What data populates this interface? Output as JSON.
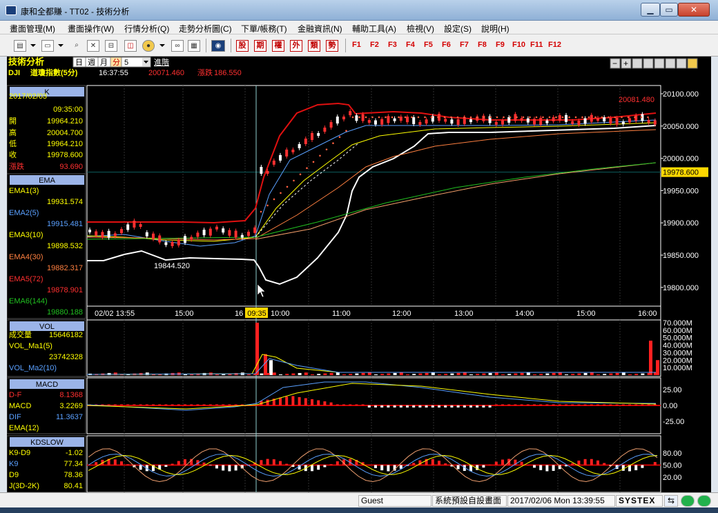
{
  "window": {
    "title": "康和全都賺 - TT02 - 技術分析"
  },
  "menu": [
    "畫面管理(M)",
    "畫面操作(W)",
    "行情分析(Q)",
    "走勢分析圖(C)",
    "下單/帳務(T)",
    "金融資訊(N)",
    "輔助工具(A)",
    "檢視(V)",
    "設定(S)",
    "說明(H)"
  ],
  "toolbar": {
    "quick": [
      "股",
      "期",
      "權",
      "外",
      "類",
      "勢"
    ],
    "fkeys": [
      "F1",
      "F2",
      "F3",
      "F4",
      "F5",
      "F6",
      "F7",
      "F8",
      "F9",
      "F10",
      "F11",
      "F12"
    ]
  },
  "header": {
    "title": "技術分析",
    "period_tabs": [
      "日",
      "週",
      "月",
      "分"
    ],
    "period_value": "5",
    "advanced": "進階",
    "symbol": "DJI",
    "name": "道瓊指數(5分)",
    "time": "16:37:55",
    "price": "20071.460",
    "change_label": "漲跌",
    "change": "186.550"
  },
  "panels": {
    "k": {
      "title": "K",
      "rows": [
        {
          "label": "2017/02/03",
          "value": ""
        },
        {
          "label": "",
          "value": "09:35:00"
        },
        {
          "label": "開",
          "value": "19964.210"
        },
        {
          "label": "高",
          "value": "20004.700"
        },
        {
          "label": "低",
          "value": "19964.210"
        },
        {
          "label": "收",
          "value": "19978.600"
        },
        {
          "label": "漲跌",
          "value": "93.690"
        }
      ]
    },
    "ema": {
      "title": "EMA",
      "items": [
        {
          "name": "EMA1(3)",
          "value": "19931.574",
          "color": "#ffff00"
        },
        {
          "name": "EMA2(5)",
          "value": "19915.481",
          "color": "#5aa0ff"
        },
        {
          "name": "EMA3(10)",
          "value": "19898.532",
          "color": "#ffff00"
        },
        {
          "name": "EMA4(30)",
          "value": "19882.317",
          "color": "#ff8040"
        },
        {
          "name": "EMA5(72)",
          "value": "19878.901",
          "color": "#ff3030"
        },
        {
          "name": "EMA6(144)",
          "value": "19880.188",
          "color": "#20c020"
        }
      ]
    },
    "vol": {
      "title": "VOL",
      "rows": [
        {
          "label": "成交量",
          "value": "15646182"
        },
        {
          "label": "VOL_Ma1(5)",
          "value": ""
        },
        {
          "label": "",
          "value": "23742328"
        },
        {
          "label": "VOL_Ma2(10)",
          "value": ""
        }
      ]
    },
    "macd": {
      "title": "MACD",
      "rows": [
        {
          "label": "D-F",
          "value": "8.1368",
          "color": "#ff3030"
        },
        {
          "label": "MACD",
          "value": "3.2269",
          "color": "#ffff00"
        },
        {
          "label": "DIF",
          "value": "11.3637",
          "color": "#5aa0ff"
        },
        {
          "label": "EMA(12)",
          "value": "",
          "color": "#ffff00"
        }
      ]
    },
    "kdslow": {
      "title": "KDSLOW",
      "rows": [
        {
          "label": "K9-D9",
          "value": "-1.02",
          "color": "#ffff00"
        },
        {
          "label": "K9",
          "value": "77.34",
          "color": "#5aa0ff"
        },
        {
          "label": "D9",
          "value": "78.36",
          "color": "#ffff00"
        },
        {
          "label": "J(3D-2K)",
          "value": "80.41",
          "color": "#ffff00"
        }
      ]
    }
  },
  "price_axis": {
    "ticks": [
      "20100.000",
      "20050.000",
      "20000.000",
      "19950.000",
      "19900.000",
      "19850.000",
      "19800.000"
    ],
    "current": "19978.600",
    "high_label": "20081.480",
    "low_label": "19844.520"
  },
  "time_axis": {
    "labels": [
      "02/02 13:55",
      "15:00",
      "16",
      "10:00",
      "11:00",
      "12:00",
      "13:00",
      "14:00",
      "15:00",
      "16:00"
    ],
    "cursor": "09:35"
  },
  "vol_axis": [
    "70.000M",
    "60.000M",
    "50.000M",
    "40.000M",
    "30.000M",
    "20.000M",
    "10.000M"
  ],
  "macd_axis": [
    "25.00",
    "0.00",
    "-25.00"
  ],
  "kd_axis": [
    "80.00",
    "50.00",
    "20.00"
  ],
  "status": {
    "user": "Guest",
    "layout": "系統預設自設畫面",
    "datetime": "2017/02/06 Mon 13:39:55",
    "brand": "SYSTEX"
  }
}
